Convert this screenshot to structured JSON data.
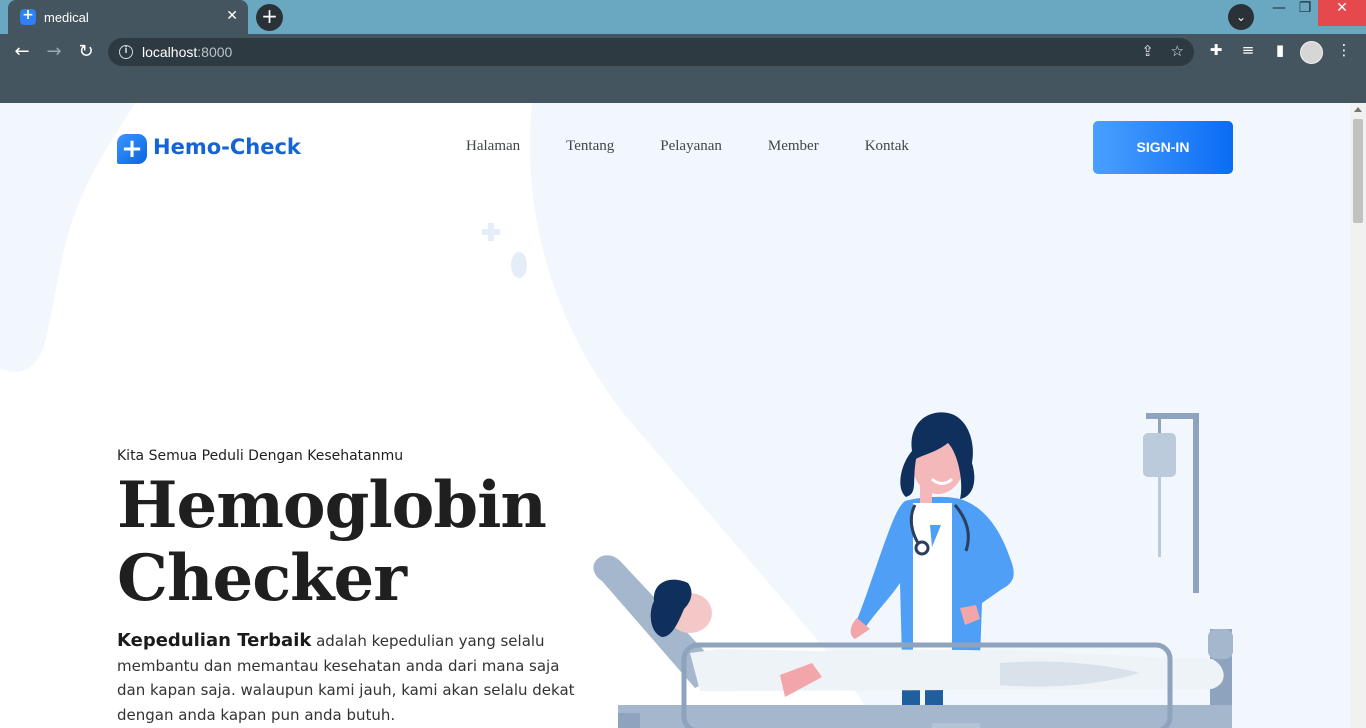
{
  "browser": {
    "tab_title": "medical",
    "tab_close": "✕",
    "new_tab": "+",
    "tab_search": "⌄",
    "window_min": "—",
    "window_max": "❐",
    "window_close": "✕",
    "url_host": "localhost",
    "url_port": ":8000",
    "icons": {
      "back": "←",
      "forward": "→",
      "reload": "↻",
      "info": "i",
      "share": "⇪",
      "star": "☆",
      "extensions": "✚",
      "media": "≡",
      "side_panel": "▮",
      "menu": "⋮"
    }
  },
  "site": {
    "brand": "Hemo-Check",
    "nav": [
      "Halaman",
      "Tentang",
      "Pelayanan",
      "Member",
      "Kontak"
    ],
    "signin_label": "SIGN-IN",
    "tagline": "Kita Semua Peduli Dengan Kesehatanmu",
    "title_line1": "Hemoglobin",
    "title_line2": "Checker",
    "desc_bold": "Kepedulian Terbaik",
    "desc_text": " adalah kepedulian yang selalu membantu dan memantau kesehatan anda dari mana saja dan kapan saja. walaupun kami jauh, kami akan selalu dekat dengan anda kapan pun anda butuh.",
    "colors": {
      "brand_blue": "#1564d6",
      "button_start": "#4aa0ff",
      "button_end": "#0b6cf4",
      "page_tint": "#f2f7fd"
    }
  }
}
